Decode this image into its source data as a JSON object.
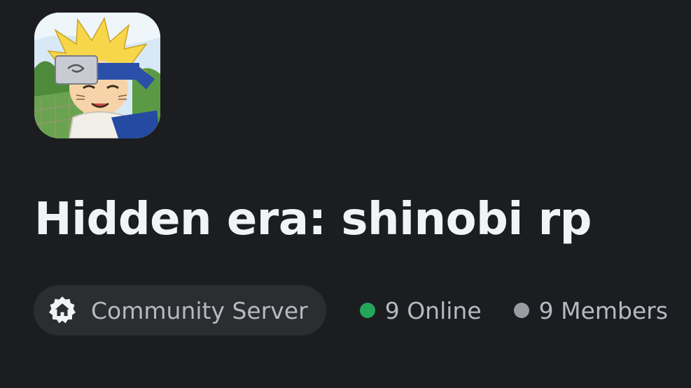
{
  "server": {
    "name": "Hidden era: shinobi rp",
    "icon": "server-avatar-anime-character"
  },
  "badge": {
    "label": "Community Server",
    "icon": "community-home-icon"
  },
  "stats": {
    "online": {
      "label": "9 Online",
      "color": "#23a55a"
    },
    "members": {
      "label": "9 Members",
      "color": "#9a9ba3"
    }
  }
}
